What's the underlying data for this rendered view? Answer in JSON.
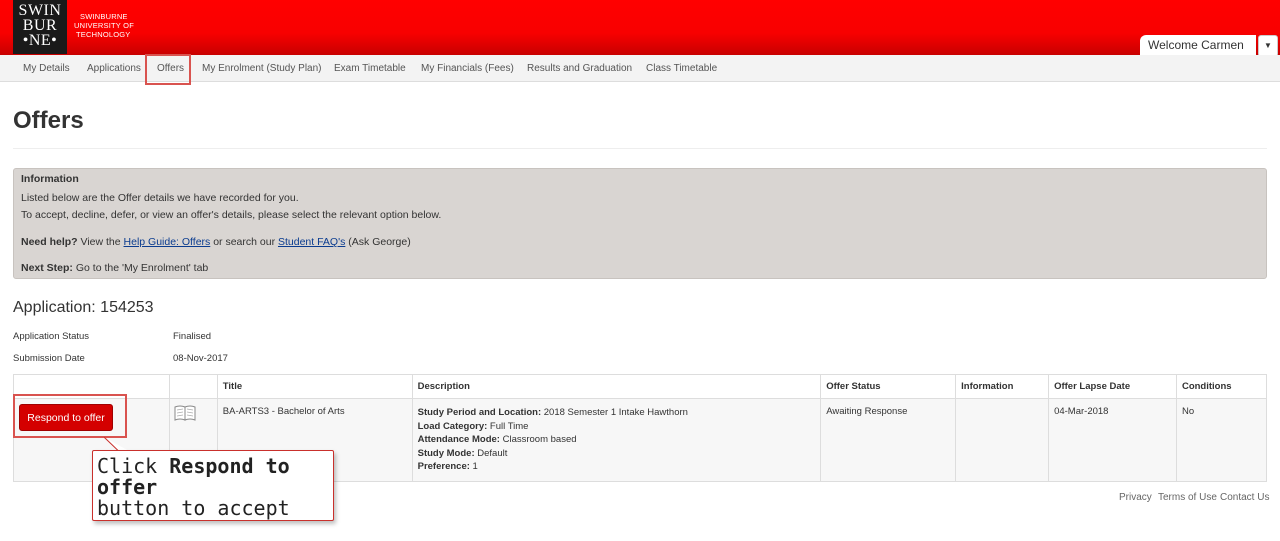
{
  "brand": {
    "logo_lines": [
      "SWIN",
      "BUR",
      "•NE•"
    ],
    "logo_caption": [
      "SWINBURNE",
      "UNIVERSITY OF",
      "TECHNOLOGY"
    ],
    "primary_color": "#ff0000"
  },
  "user": {
    "welcome": "Welcome Carmen"
  },
  "nav": {
    "tabs": [
      {
        "label": "My Details"
      },
      {
        "label": "Applications"
      },
      {
        "label": "Offers",
        "active": true
      },
      {
        "label": "My Enrolment (Study Plan)"
      },
      {
        "label": "Exam Timetable"
      },
      {
        "label": "My Financials (Fees)"
      },
      {
        "label": "Results and Graduation"
      },
      {
        "label": "Class Timetable"
      }
    ]
  },
  "page": {
    "title": "Offers"
  },
  "info": {
    "heading": "Information",
    "line1": "Listed below are the Offer details we have recorded for you.",
    "line2": "To accept, decline, defer, or view an offer's details, please select the relevant option below.",
    "help_label": "Need help?",
    "help_text1": " View the ",
    "help_link1": "Help Guide: Offers",
    "help_text2": " or search our ",
    "help_link2": "Student FAQ's",
    "help_text3": " (Ask George)",
    "next_label": "Next Step:",
    "next_text": " Go to the 'My Enrolment' tab"
  },
  "application": {
    "heading": "Application: 154253",
    "status_label": "Application Status",
    "status_value": "Finalised",
    "submission_label": "Submission Date",
    "submission_value": "08-Nov-2017"
  },
  "table": {
    "headers": [
      "",
      "",
      "Title",
      "Description",
      "Offer Status",
      "Information",
      "Offer Lapse Date",
      "Conditions"
    ],
    "row": {
      "action_label": "Respond to offer",
      "icon": "book-icon",
      "title": "BA-ARTS3 - Bachelor of Arts",
      "desc": [
        {
          "label": "Study Period and Location:",
          "value": " 2018 Semester 1 Intake Hawthorn"
        },
        {
          "label": "Load Category:",
          "value": " Full Time"
        },
        {
          "label": "Attendance Mode:",
          "value": " Classroom based"
        },
        {
          "label": "Study Mode:",
          "value": " Default"
        },
        {
          "label": "Preference:",
          "value": " 1"
        }
      ],
      "offer_status": "Awaiting Response",
      "information": "",
      "lapse_date": "04-Mar-2018",
      "conditions": "No"
    }
  },
  "callout": {
    "prefix": "Click ",
    "bold": "Respond to offer",
    "suffix": "button to accept"
  },
  "footer": {
    "links": [
      "Privacy",
      "Terms of Use",
      "Contact Us"
    ]
  }
}
